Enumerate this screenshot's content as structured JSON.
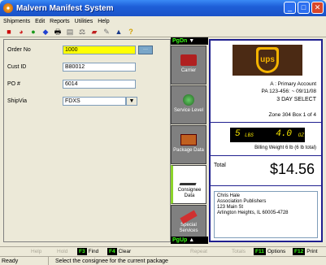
{
  "window": {
    "title": "Malvern Manifest System"
  },
  "menu": [
    {
      "label": "Shipments"
    },
    {
      "label": "Edit"
    },
    {
      "label": "Reports"
    },
    {
      "label": "Utilities"
    },
    {
      "label": "Help"
    }
  ],
  "toolbar": {
    "icons": [
      "record-icon",
      "eraser-icon",
      "green-ball-icon",
      "diamond-icon",
      "print-icon",
      "printer2-icon",
      "scale-icon",
      "truck-icon",
      "pencil-icon",
      "mountain-icon",
      "help-icon"
    ]
  },
  "form": {
    "order_no": {
      "label": "Order No",
      "value": "1000"
    },
    "cust_id": {
      "label": "Cust ID",
      "value": "B80012"
    },
    "po": {
      "label": "PO #",
      "value": "6014"
    },
    "ship_via": {
      "label": "ShipVia",
      "value": "FDXS"
    }
  },
  "sidenav": {
    "pgdn": "PgDn",
    "pgup": "PgUp",
    "tabs": [
      {
        "label": "Carrier"
      },
      {
        "label": "Service Level"
      },
      {
        "label": "Package Data"
      },
      {
        "label": "Consignee Data"
      },
      {
        "label": "Special Services"
      }
    ]
  },
  "carrier_info": {
    "logo_text": "ups",
    "account": "A : Primary Account",
    "pa_line": "PA 123-456:  ~ 09/11/08",
    "service": "3 DAY SELECT",
    "zone_box": "Zone 304   Box 1 of 4"
  },
  "weight": {
    "lbs": "5",
    "lbs_unit": "LBS",
    "oz": "4.0",
    "oz_unit": "OZ",
    "billing": "Billing Weight 6 lb (6 lb total)"
  },
  "total": {
    "label": "Total",
    "amount": "$14.56"
  },
  "address": {
    "lines": [
      "Chris Hale",
      "Association Publishers",
      "123 Main St",
      "Arlington Heights, IL 60005-4728"
    ]
  },
  "fbar": {
    "help": "Help",
    "hold": "Hold",
    "f3_key": "F3",
    "f3": "Find",
    "f4_key": "F4",
    "f4": "Clear",
    "repeat": "Repeat",
    "totals": "Totals",
    "f11_key": "F11",
    "f11": "Options",
    "f12_key": "F12",
    "f12": "Print"
  },
  "status": {
    "state": "Ready",
    "message": "Select the consignee for the current package"
  }
}
